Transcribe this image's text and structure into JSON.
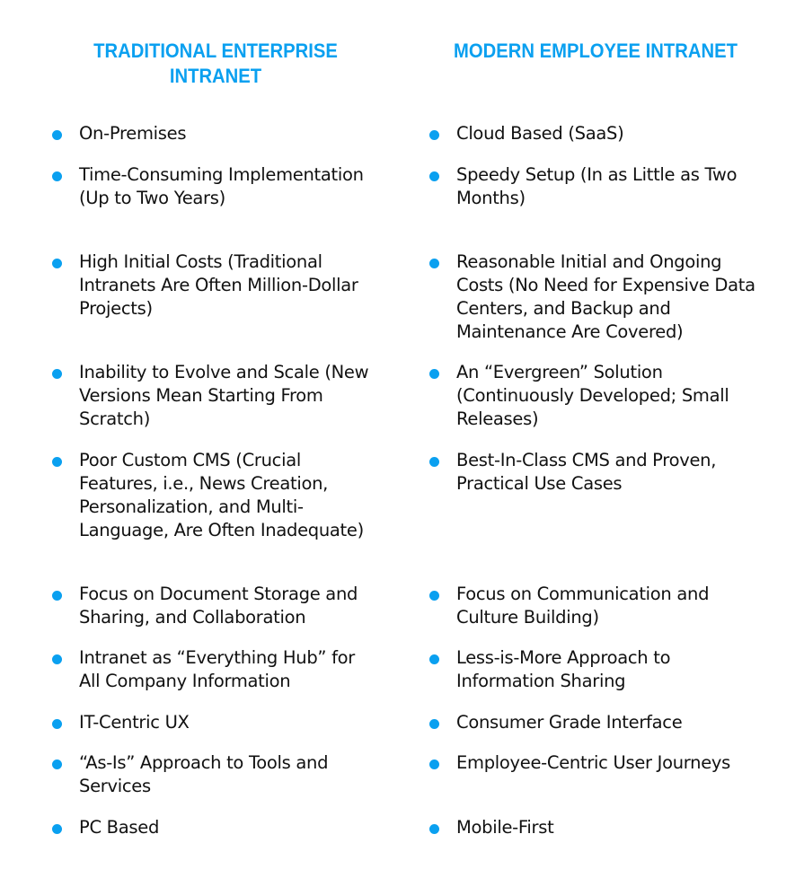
{
  "columns": [
    {
      "heading": "TRADITIONAL ENTERPRISE INTRANET",
      "items": [
        "On-Premises",
        "Time-Consuming Implementation (Up to Two Years)",
        "High Initial Costs (Traditional Intranets Are Often Million-Dollar Projects)",
        "Inability to Evolve and Scale (New Versions Mean Starting From Scratch)",
        "Poor Custom CMS (Crucial Features, i.e., News Creation, Personalization, and Multi-Language, Are Often Inadequate)",
        "Focus on Document Storage and Sharing, and Collaboration",
        "Intranet as “Everything Hub” for All Company Information",
        "IT-Centric UX",
        "“As-Is” Approach to Tools and Services",
        "PC Based"
      ]
    },
    {
      "heading": "MODERN EMPLOYEE INTRANET",
      "items": [
        "Cloud Based (SaaS)",
        "Speedy Setup (In as Little as Two Months)",
        "Reasonable Initial and Ongoing Costs (No Need for Expensive Data Centers, and Backup and Maintenance Are Covered)",
        "An “Evergreen” Solution (Continuously Developed; Small Releases)",
        "Best-In-Class CMS and Proven, Practical Use Cases",
        "Focus on Communication and Culture Building)",
        "Less-is-More Approach to Information Sharing",
        "Consumer Grade Interface",
        "Employee-Centric User Journeys",
        "Mobile-First"
      ]
    }
  ],
  "colors": {
    "accent": "#0aa0f0",
    "text": "#111111"
  }
}
